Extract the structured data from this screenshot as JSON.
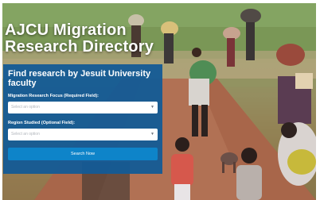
{
  "hero": {
    "title": "AJCU Migration\nResearch Directory",
    "background_image": "photo of migrants with bundles walking along a red dirt road"
  },
  "search_panel": {
    "heading": "Find research by Jesuit University faculty",
    "focus": {
      "label": "Migration Research Focus (Required Field):",
      "placeholder": "Select an option"
    },
    "region": {
      "label": "Region Studied (Optional Field):",
      "placeholder": "Select an option"
    },
    "submit_label": "Search Now"
  },
  "colors": {
    "panel": "#135b96",
    "button": "#0e84c9",
    "title_text": "#ffffff"
  },
  "icons": {
    "dropdown": "chevron-down-icon"
  }
}
